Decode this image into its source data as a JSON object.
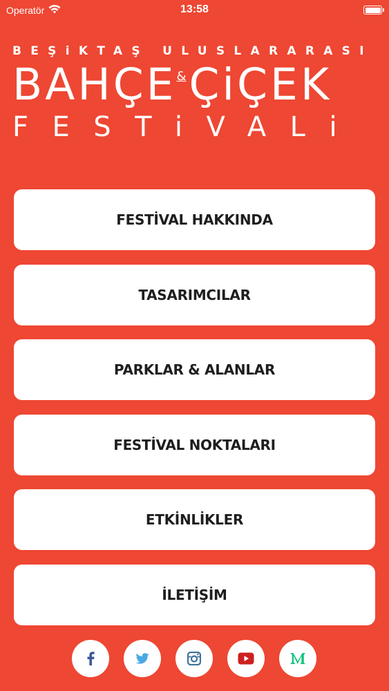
{
  "status_bar": {
    "carrier": "Operatör",
    "time": "13:58"
  },
  "logo": {
    "line1": "BEŞiKTAŞ ULUSLARARASI",
    "word1": "BAHÇE",
    "amp": "&",
    "word2": "ÇiÇEK",
    "line3": "FESTiVALi"
  },
  "menu": {
    "items": [
      {
        "label": "FESTİVAL HAKKINDA"
      },
      {
        "label": "TASARIMCILAR"
      },
      {
        "label": "PARKLAR & ALANLAR"
      },
      {
        "label": "FESTİVAL NOKTALARI"
      },
      {
        "label": "ETKİNLİKLER"
      },
      {
        "label": "İLETİŞİM"
      }
    ]
  },
  "social": {
    "icons": [
      {
        "icon": "facebook-icon",
        "color": "#3b5998"
      },
      {
        "icon": "twitter-icon",
        "color": "#4aa8e6"
      },
      {
        "icon": "instagram-icon",
        "color": "#3f729b"
      },
      {
        "icon": "youtube-icon",
        "color": "#cd201f"
      },
      {
        "icon": "medium-icon",
        "color": "#12c47f"
      }
    ]
  },
  "colors": {
    "background": "#ee4733",
    "button": "#ffffff",
    "button_text": "#1e1e1e"
  }
}
